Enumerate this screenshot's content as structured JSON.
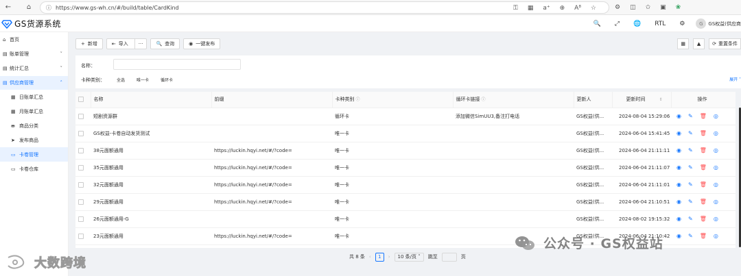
{
  "browser": {
    "url": "https://www.gs-wh.cn/#/build/table/CardKind",
    "icons": [
      "back-icon",
      "home-icon",
      "info-icon",
      "key-icon",
      "grid-icon",
      "read-aloud-icon",
      "zoom-icon",
      "font-icon",
      "favorite-icon",
      "extensions-icon",
      "split-icon",
      "favorites-bar-icon",
      "collections-icon",
      "copilot-icon"
    ]
  },
  "app": {
    "brand": "GS货源系统",
    "brand_color": "#1677ff",
    "header": {
      "rtl": "RTL",
      "avatar": "G",
      "user": "GS权益(供应商"
    }
  },
  "sidebar": {
    "items": [
      {
        "icon": "home-icon",
        "label": "首页"
      },
      {
        "icon": "ledger-icon",
        "label": "账单管理",
        "caret": "˅"
      },
      {
        "icon": "stats-icon",
        "label": "统计汇总",
        "caret": "˅"
      },
      {
        "icon": "supplier-icon",
        "label": "供应商管理",
        "caret": "˄"
      }
    ],
    "sub_items": [
      {
        "icon": "table-icon",
        "label": "日账单汇总"
      },
      {
        "icon": "table-icon",
        "label": "月账单汇总"
      },
      {
        "icon": "category-icon",
        "label": "商品分类"
      },
      {
        "icon": "send-icon",
        "label": "发布商品"
      },
      {
        "icon": "card-icon",
        "label": "卡卷管理"
      },
      {
        "icon": "warehouse-icon",
        "label": "卡卷仓库"
      }
    ]
  },
  "toolbar": {
    "add": "新增",
    "import": "导入",
    "more": "···",
    "query": "查询",
    "publish": "一键发布",
    "reset": "重置条件"
  },
  "search": {
    "name_label": "名称：",
    "name_value": "",
    "kind_label": "卡种类别：",
    "kind_options": [
      "全选",
      "唯一卡",
      "循环卡"
    ],
    "expand": "展开"
  },
  "table": {
    "columns": [
      "名称",
      "前缀",
      "卡种类别",
      "循环卡链接",
      "更新人",
      "更新时间",
      "操作"
    ],
    "rows": [
      {
        "name": "短剧资源群",
        "prefix": "",
        "kind": "循环卡",
        "link": "添加微信SimUU3,备注打电话",
        "updater": "GS权益(供...",
        "time": "2024-08-04 15:29:06"
      },
      {
        "name": "GS权益-卡卷自动发货测试",
        "prefix": "",
        "kind": "唯一卡",
        "link": "",
        "updater": "GS权益(供...",
        "time": "2024-06-04 15:41:45"
      },
      {
        "name": "38元面额通用",
        "prefix": "https://luckin.hqyi.net/#/?code=",
        "kind": "唯一卡",
        "link": "",
        "updater": "GS权益(供...",
        "time": "2024-06-04 21:11:11"
      },
      {
        "name": "35元面额通用",
        "prefix": "https://luckin.hqyi.net/#/?code=",
        "kind": "唯一卡",
        "link": "",
        "updater": "GS权益(供...",
        "time": "2024-06-04 21:11:07"
      },
      {
        "name": "32元面额通用",
        "prefix": "https://luckin.hqyi.net/#/?code=",
        "kind": "唯一卡",
        "link": "",
        "updater": "GS权益(供...",
        "time": "2024-06-04 21:11:01"
      },
      {
        "name": "29元面额通用",
        "prefix": "https://luckin.hqyi.net/#/?code=",
        "kind": "唯一卡",
        "link": "",
        "updater": "GS权益(供...",
        "time": "2024-06-04 21:10:51"
      },
      {
        "name": "26元面额通用-G",
        "prefix": "",
        "kind": "唯一卡",
        "link": "",
        "updater": "GS权益(供...",
        "time": "2024-08-02 19:15:32"
      },
      {
        "name": "23元面额通用",
        "prefix": "https://luckin.hqyi.net/#/?code=",
        "kind": "唯一卡",
        "link": "",
        "updater": "GS权益(供...",
        "time": "2024-06-04 21:10:42"
      }
    ]
  },
  "pagination": {
    "total": "共 8 条",
    "current": "1",
    "page_size": "10 条/页",
    "jump_label": "跳至",
    "page_unit": "页"
  },
  "watermark": {
    "left": "大数跨境",
    "right": "公众号 · GS权益站"
  }
}
